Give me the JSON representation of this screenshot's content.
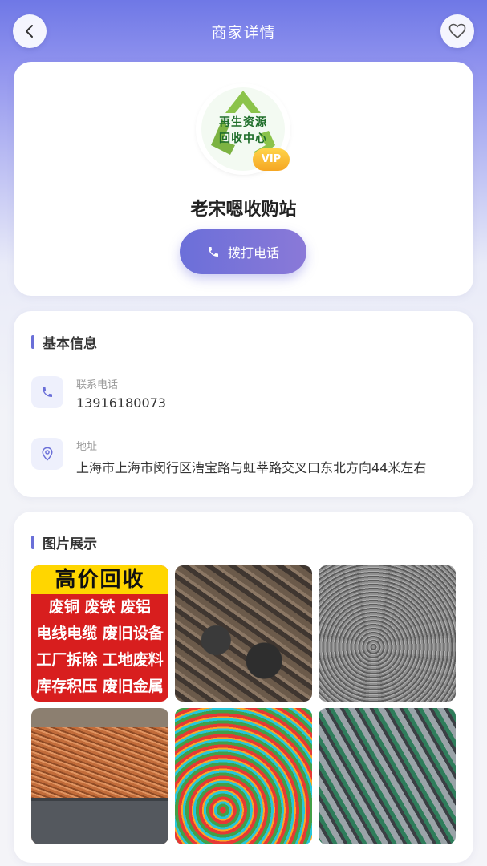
{
  "header": {
    "title": "商家详情",
    "back_icon": "chevron-left-icon",
    "favorite_icon": "heart-outline-icon"
  },
  "merchant": {
    "logo_text_line1": "再生资源",
    "logo_text_line2": "回收中心",
    "vip_badge": "VIP",
    "name": "老宋嗯收购站",
    "call_button_label": "拨打电话",
    "call_icon": "phone-icon"
  },
  "basic_info": {
    "section_title": "基本信息",
    "phone_label": "联系电话",
    "phone_value": "13916180073",
    "phone_icon": "phone-icon",
    "address_label": "地址",
    "address_value": "上海市上海市闵行区漕宝路与虹莘路交叉口东北方向44米左右",
    "address_icon": "location-pin-icon"
  },
  "gallery": {
    "section_title": "图片展示",
    "sign": {
      "title": "高价回收",
      "line1": "废铜 废铁 废铝",
      "line2": "电线电缆 废旧设备",
      "line3": "工厂拆除 工地废料",
      "line4": "库存积压 废旧金属"
    }
  },
  "colors": {
    "accent": "#6a6fd8",
    "header_gradient_top": "#6f78e6",
    "vip_gold": "#f5a623",
    "logo_green": "#1f6e2a"
  }
}
